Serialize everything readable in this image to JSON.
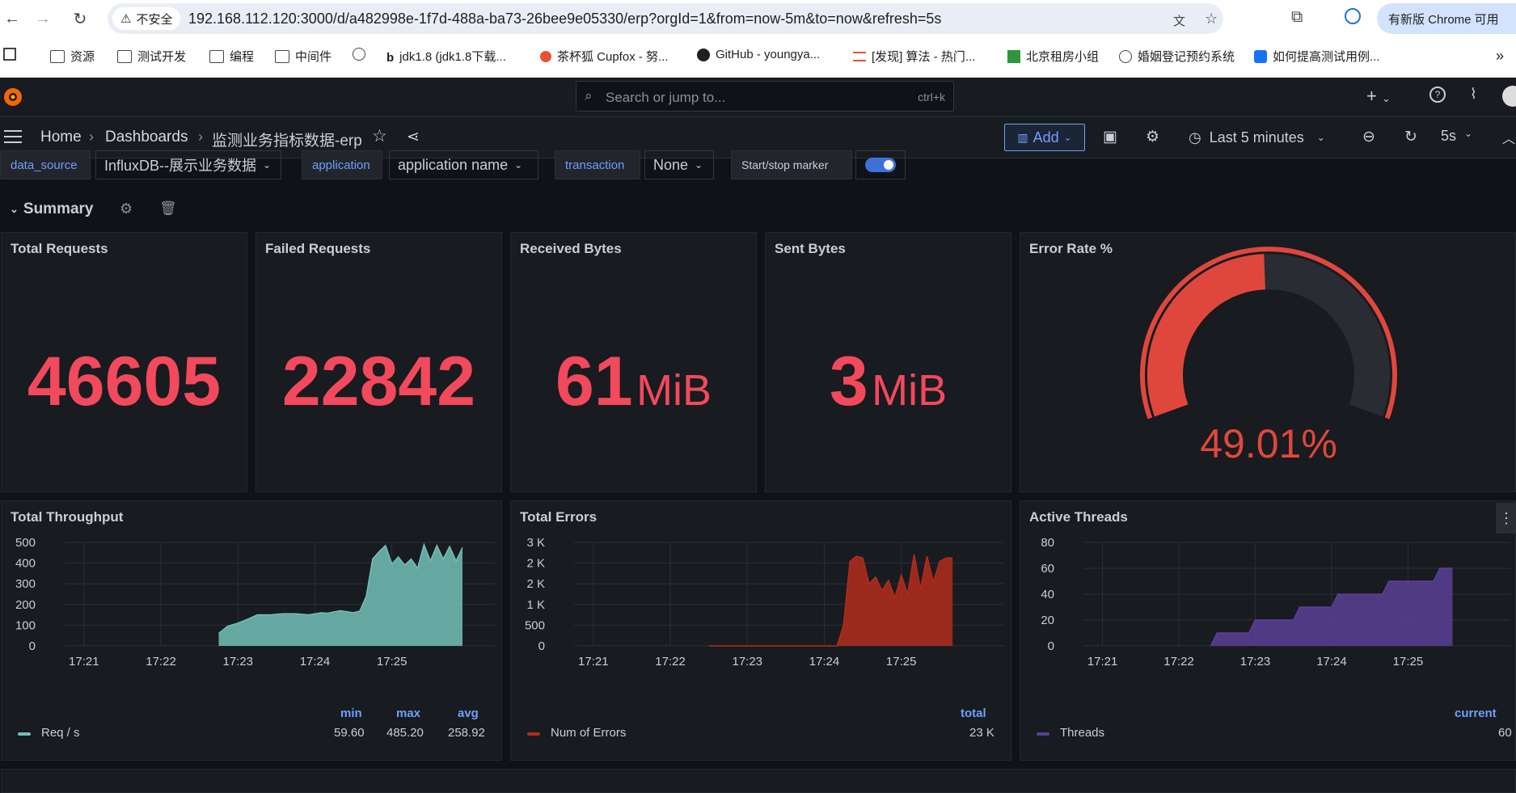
{
  "browser": {
    "insecure_label": "不安全",
    "url": "192.168.112.120:3000/d/a482998e-1f7d-488a-ba73-26bee9e05330/erp?orgId=1&from=now-5m&to=now&refresh=5s",
    "update_label": "有新版 Chrome 可用",
    "bookmarks": [
      "资源",
      "测试开发",
      "编程",
      "中间件",
      "jdk1.8 (jdk1.8下载...",
      "茶杯狐 Cupfox - 努...",
      "GitHub - youngya...",
      "[发现] 算法 - 热门...",
      "北京租房小组",
      "婚姻登记预约系统",
      "如何提高测试用例..."
    ]
  },
  "topbar": {
    "search_placeholder": "Search or jump to...",
    "search_shortcut": "ctrl+k"
  },
  "navbar": {
    "breadcrumbs": [
      "Home",
      "Dashboards",
      "监测业务指标数据-erp"
    ],
    "add_label": "Add",
    "time_range": "Last 5 minutes",
    "refresh_interval": "5s"
  },
  "variables": {
    "data_source_label": "data_source",
    "data_source_value": "InfluxDB--展示业务数据",
    "application_label": "application",
    "application_value": "application name",
    "transaction_label": "transaction",
    "transaction_value": "None",
    "marker_label": "Start/stop marker",
    "marker_on": true
  },
  "row": {
    "title": "Summary"
  },
  "panels": {
    "total_requests": {
      "title": "Total Requests",
      "value": "46605"
    },
    "failed_requests": {
      "title": "Failed Requests",
      "value": "22842"
    },
    "received_bytes": {
      "title": "Received Bytes",
      "value": "61",
      "unit": "MiB"
    },
    "sent_bytes": {
      "title": "Sent Bytes",
      "value": "3",
      "unit": "MiB"
    },
    "error_rate": {
      "title": "Error Rate %",
      "value": "49.01%",
      "fraction": 0.4901
    },
    "total_throughput": {
      "title": "Total Throughput",
      "legend": {
        "series": "Req / s",
        "col_min": "min",
        "col_max": "max",
        "col_avg": "avg",
        "min": "59.60",
        "max": "485.20",
        "avg": "258.92"
      }
    },
    "total_errors": {
      "title": "Total Errors",
      "legend": {
        "series": "Num of Errors",
        "col_total": "total",
        "total": "23 K"
      }
    },
    "active_threads": {
      "title": "Active Threads",
      "legend": {
        "series": "Threads",
        "col_current": "current",
        "current": "60"
      }
    }
  },
  "colors": {
    "stat": "#f2495c",
    "gauge": "#e0473c",
    "throughput": "#73bfb8",
    "errors": "#b32c1c",
    "threads": "#5a3f95",
    "accent": "#6e9fff"
  },
  "chart_data": [
    {
      "type": "area",
      "title": "Total Throughput",
      "x_ticks": [
        "17:21",
        "17:22",
        "17:23",
        "17:24",
        "17:25"
      ],
      "y_ticks": [
        "500",
        "400",
        "300",
        "200",
        "100",
        "0"
      ],
      "ylim": [
        0,
        500
      ],
      "x": [
        "17:21:40",
        "17:22:00",
        "17:22:30",
        "17:22:45",
        "17:22:52",
        "17:23:00",
        "17:23:08",
        "17:23:15",
        "17:23:25",
        "17:23:35",
        "17:23:45",
        "17:23:55",
        "17:24:05",
        "17:24:10",
        "17:24:15",
        "17:24:20",
        "17:24:25",
        "17:24:30",
        "17:24:35",
        "17:24:40",
        "17:24:45",
        "17:24:50",
        "17:24:55",
        "17:25:00",
        "17:25:05",
        "17:25:10",
        "17:25:15",
        "17:25:20",
        "17:25:25",
        "17:25:30",
        "17:25:35",
        "17:25:40",
        "17:25:45",
        "17:25:50",
        "17:25:55"
      ],
      "series": [
        {
          "name": "Req / s",
          "values": [
            null,
            null,
            null,
            60,
            95,
            110,
            130,
            150,
            150,
            155,
            155,
            150,
            160,
            158,
            165,
            170,
            165,
            160,
            168,
            240,
            420,
            455,
            485,
            395,
            430,
            390,
            420,
            375,
            490,
            410,
            485,
            420,
            480,
            410,
            475
          ]
        }
      ]
    },
    {
      "type": "area",
      "title": "Total Errors",
      "x_ticks": [
        "17:21",
        "17:22",
        "17:23",
        "17:24",
        "17:25"
      ],
      "y_ticks": [
        "3 K",
        "2 K",
        "2 K",
        "1 K",
        "500",
        "0"
      ],
      "ylim": [
        0,
        3000
      ],
      "x": [
        "17:21:30",
        "17:22:30",
        "17:23:00",
        "17:23:30",
        "17:24:00",
        "17:24:10",
        "17:24:15",
        "17:24:20",
        "17:24:25",
        "17:24:30",
        "17:24:35",
        "17:24:40",
        "17:24:45",
        "17:24:50",
        "17:24:55",
        "17:25:00",
        "17:25:05",
        "17:25:10",
        "17:25:15",
        "17:25:20",
        "17:25:25",
        "17:25:30",
        "17:25:35",
        "17:25:40"
      ],
      "series": [
        {
          "name": "Num of Errors",
          "values": [
            null,
            0,
            0,
            0,
            0,
            0,
            600,
            2450,
            2600,
            2550,
            1800,
            2000,
            1600,
            1900,
            1400,
            2050,
            1500,
            2650,
            1650,
            2600,
            1850,
            2450,
            2550,
            2550
          ]
        }
      ]
    },
    {
      "type": "area",
      "title": "Active Threads",
      "x_ticks": [
        "17:21",
        "17:22",
        "17:23",
        "17:24",
        "17:25"
      ],
      "y_ticks": [
        "80",
        "60",
        "40",
        "20",
        "0"
      ],
      "ylim": [
        0,
        80
      ],
      "x": [
        "17:22:25",
        "17:22:30",
        "17:22:35",
        "17:22:55",
        "17:23:00",
        "17:23:05",
        "17:23:30",
        "17:23:35",
        "17:23:40",
        "17:24:00",
        "17:24:05",
        "17:24:10",
        "17:24:40",
        "17:24:45",
        "17:25:00",
        "17:25:20",
        "17:25:25",
        "17:25:35"
      ],
      "series": [
        {
          "name": "Threads",
          "values": [
            0,
            10,
            10,
            10,
            20,
            20,
            20,
            30,
            30,
            30,
            40,
            40,
            40,
            50,
            50,
            50,
            60,
            60
          ]
        }
      ]
    }
  ]
}
